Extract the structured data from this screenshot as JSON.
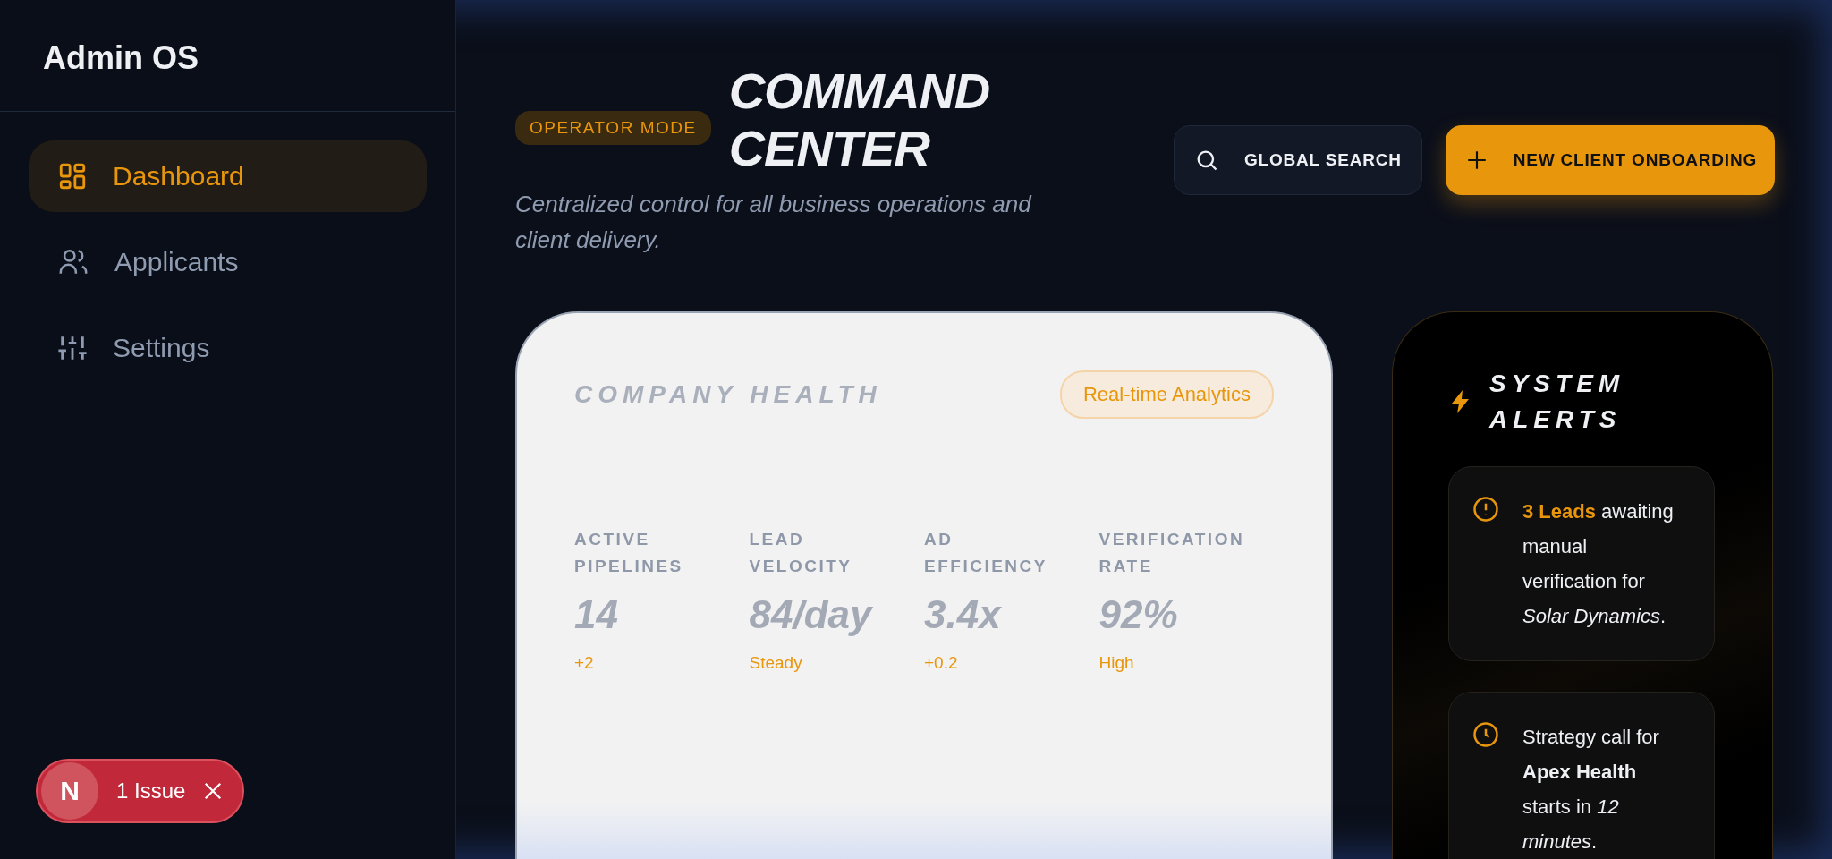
{
  "sidebar": {
    "logo": "Admin OS",
    "items": [
      {
        "label": "Dashboard",
        "kind": "grid",
        "selected": true
      },
      {
        "label": "Applicants",
        "kind": "users",
        "selected": false
      },
      {
        "label": "Settings",
        "kind": "sliders",
        "selected": false
      }
    ]
  },
  "header": {
    "badge": "OPERATOR MODE",
    "title": "COMMAND CENTER",
    "subtitle": "Centralized control for all business operations and client delivery.",
    "search_button": "GLOBAL SEARCH",
    "primary_button": "NEW CLIENT ONBOARDING"
  },
  "health": {
    "title": "COMPANY HEALTH",
    "tag": "Real-time Analytics",
    "metrics": [
      {
        "label": "ACTIVE PIPELINES",
        "value": "14",
        "delta": "+2"
      },
      {
        "label": "LEAD VELOCITY",
        "value": "84/day",
        "delta": "Steady"
      },
      {
        "label": "AD EFFICIENCY",
        "value": "3.4x",
        "delta": "+0.2"
      },
      {
        "label": "VERIFICATION RATE",
        "value": "92%",
        "delta": "High"
      }
    ]
  },
  "alerts": {
    "title": "SYSTEM ALERTS",
    "items": [
      {
        "kind": "warning",
        "text": "**3 Leads** awaiting manual verification for *Solar Dynamics*."
      },
      {
        "kind": "time",
        "text": "Strategy call for **Apex Health** starts in *12 minutes*."
      }
    ]
  },
  "issue_badge": {
    "logo": "N",
    "label": "1 Issue"
  }
}
